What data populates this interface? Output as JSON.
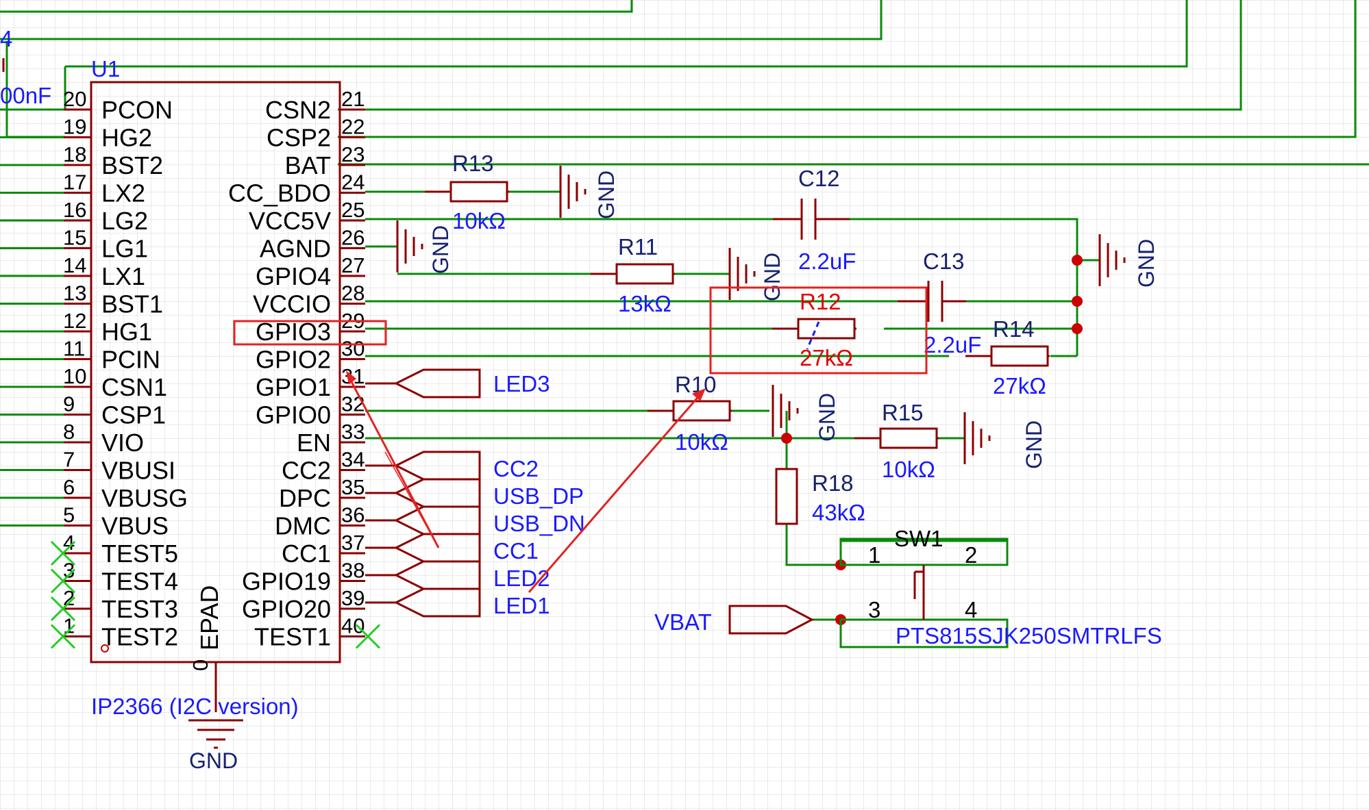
{
  "colors": {
    "wire": "#0a8a0a",
    "component": "#8b0000",
    "label": "#1a1aff",
    "net_name": "#16216e",
    "highlight": "#e32222",
    "junction": "#cc0000",
    "grid": "#d6d6d6",
    "noconnect": "#22cc22"
  },
  "chip": {
    "designator": "U1",
    "part": "IP2366 (I2C version)",
    "pad_pin": "0",
    "pad_name": "EPAD",
    "left_pins": [
      {
        "num": "20",
        "name": "PCON"
      },
      {
        "num": "19",
        "name": "HG2"
      },
      {
        "num": "18",
        "name": "BST2"
      },
      {
        "num": "17",
        "name": "LX2"
      },
      {
        "num": "16",
        "name": "LG2"
      },
      {
        "num": "15",
        "name": "LG1"
      },
      {
        "num": "14",
        "name": "LX1"
      },
      {
        "num": "13",
        "name": "BST1"
      },
      {
        "num": "12",
        "name": "HG1"
      },
      {
        "num": "11",
        "name": "PCIN"
      },
      {
        "num": "10",
        "name": "CSN1"
      },
      {
        "num": "9",
        "name": "CSP1"
      },
      {
        "num": "8",
        "name": "VIO"
      },
      {
        "num": "7",
        "name": "VBUSI"
      },
      {
        "num": "6",
        "name": "VBUSG"
      },
      {
        "num": "5",
        "name": "VBUS"
      },
      {
        "num": "4",
        "name": "TEST5"
      },
      {
        "num": "3",
        "name": "TEST4"
      },
      {
        "num": "2",
        "name": "TEST3"
      },
      {
        "num": "1",
        "name": "TEST2"
      }
    ],
    "right_pins": [
      {
        "num": "21",
        "name": "CSN2"
      },
      {
        "num": "22",
        "name": "CSP2"
      },
      {
        "num": "23",
        "name": "BAT"
      },
      {
        "num": "24",
        "name": "CC_BDO"
      },
      {
        "num": "25",
        "name": "VCC5V"
      },
      {
        "num": "26",
        "name": "AGND"
      },
      {
        "num": "27",
        "name": "GPIO4"
      },
      {
        "num": "28",
        "name": "VCCIO"
      },
      {
        "num": "29",
        "name": "GPIO3"
      },
      {
        "num": "30",
        "name": "GPIO2"
      },
      {
        "num": "31",
        "name": "GPIO1"
      },
      {
        "num": "32",
        "name": "GPIO0"
      },
      {
        "num": "33",
        "name": "EN"
      },
      {
        "num": "34",
        "name": "CC2"
      },
      {
        "num": "35",
        "name": "DPC"
      },
      {
        "num": "36",
        "name": "DMC"
      },
      {
        "num": "37",
        "name": "CC1"
      },
      {
        "num": "38",
        "name": "GPIO19"
      },
      {
        "num": "39",
        "name": "GPIO20"
      },
      {
        "num": "40",
        "name": "TEST1"
      }
    ]
  },
  "fragments": {
    "left_cap_value": "00nF",
    "left_ref": "4"
  },
  "resistors": [
    {
      "ref": "R13",
      "value": "10kΩ"
    },
    {
      "ref": "R11",
      "value": "13kΩ"
    },
    {
      "ref": "R12",
      "value": "27kΩ"
    },
    {
      "ref": "R14",
      "value": "27kΩ"
    },
    {
      "ref": "R10",
      "value": "10kΩ"
    },
    {
      "ref": "R15",
      "value": "10kΩ"
    },
    {
      "ref": "R18",
      "value": "43kΩ"
    }
  ],
  "capacitors": [
    {
      "ref": "C12",
      "value": "2.2uF"
    },
    {
      "ref": "C13",
      "value": "2.2uF"
    }
  ],
  "gnd_label": "GND",
  "net_flags": [
    "LED3",
    "CC2",
    "USB_DP",
    "USB_DN",
    "CC1",
    "LED2",
    "LED1",
    "VBAT"
  ],
  "switch": {
    "ref": "SW1",
    "part": "PTS815SJK250SMTRLFS",
    "pins": [
      "1",
      "2",
      "3",
      "4"
    ]
  }
}
